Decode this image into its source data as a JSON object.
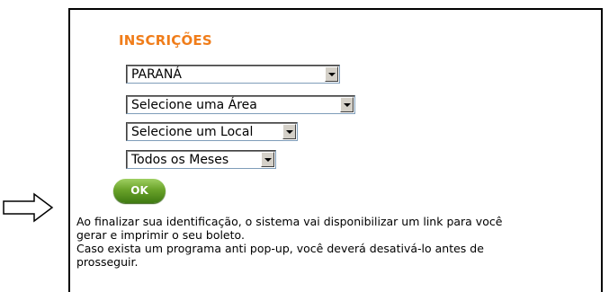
{
  "title": "INSCRIÇÕES",
  "selects": {
    "state": "PARANÁ",
    "area": "Selecione uma Área",
    "local": "Selecione um Local",
    "month": "Todos os Meses"
  },
  "ok_label": "OK",
  "info_lines": [
    "Ao finalizar sua identificação, o sistema vai disponibilizar um link para você",
    "gerar e imprimir o seu boleto.",
    "Caso exista um programa anti pop-up, você deverá desativá-lo antes de",
    "prosseguir."
  ],
  "colors": {
    "title": "#f07d1a",
    "button": "#5f9a22"
  },
  "icons": {
    "pointer": "right-arrow-icon"
  }
}
